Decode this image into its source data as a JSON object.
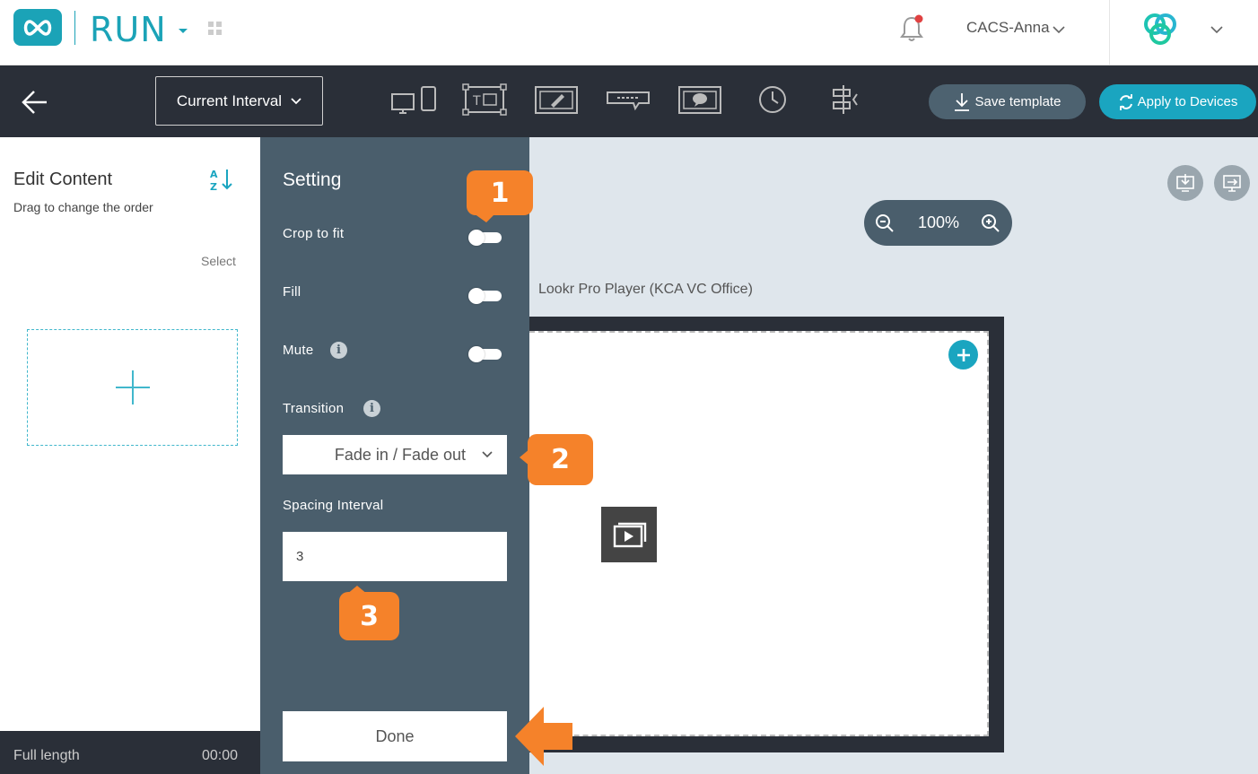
{
  "header": {
    "app_name": "RUN",
    "user_name": "CACS-Anna"
  },
  "toolbar": {
    "interval_label": "Current Interval",
    "save_label": "Save template",
    "apply_label": "Apply to Devices"
  },
  "left_panel": {
    "title": "Edit Content",
    "subtitle": "Drag to change the order",
    "select_label": "Select",
    "footer_label": "Full length",
    "footer_time": "00:00"
  },
  "settings": {
    "title": "Setting",
    "crop_label": "Crop to fit",
    "fill_label": "Fill",
    "mute_label": "Mute",
    "transition_label": "Transition",
    "transition_value": "Fade in / Fade out",
    "spacing_label": "Spacing Interval",
    "spacing_value": "3",
    "done_label": "Done"
  },
  "canvas": {
    "zoom": "100%",
    "player_name": "Lookr Pro Player (KCA VC Office)"
  },
  "annotations": {
    "badge1": "1",
    "badge2": "2",
    "badge3": "3"
  },
  "colors": {
    "accent": "#1ba3b7",
    "toolbar_bg": "#2a2f38",
    "settings_bg": "#4a5e6c",
    "canvas_bg": "#dfe6ec",
    "annotation": "#f5822a"
  }
}
